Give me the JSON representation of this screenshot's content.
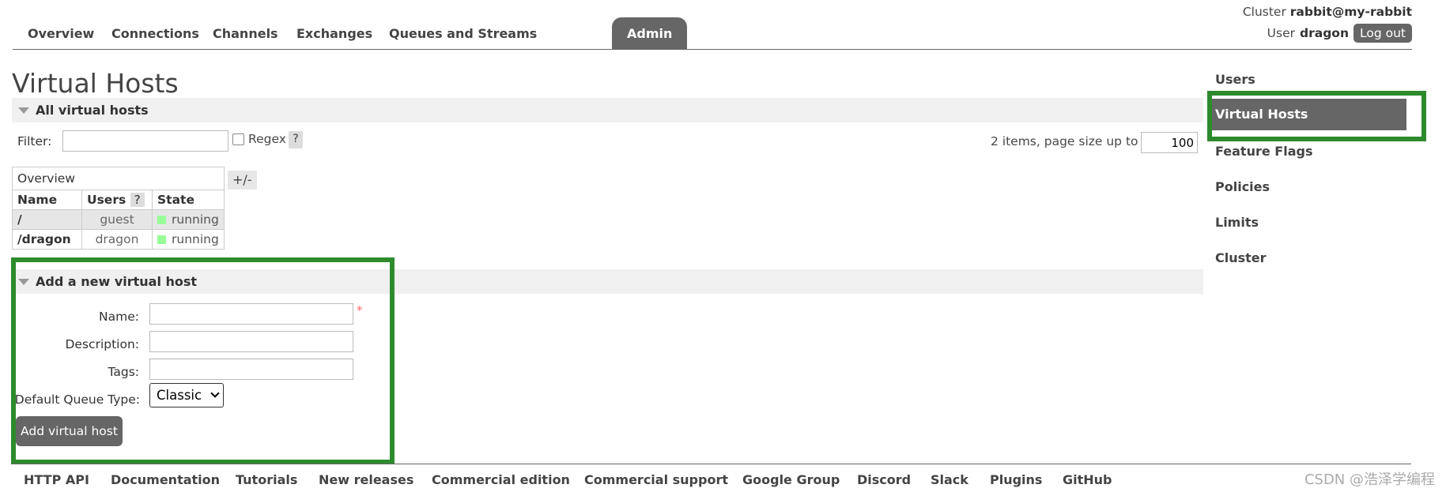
{
  "nav": {
    "tabs": [
      {
        "label": "Overview"
      },
      {
        "label": "Connections"
      },
      {
        "label": "Channels"
      },
      {
        "label": "Exchanges"
      },
      {
        "label": "Queues and Streams"
      },
      {
        "label": "Admin",
        "active": true
      }
    ]
  },
  "header": {
    "cluster_label": "Cluster",
    "cluster_name": "rabbit@my-rabbit",
    "user_label": "User",
    "user_name": "dragon",
    "logout_label": "Log out"
  },
  "page_title": "Virtual Hosts",
  "all_vhosts": {
    "section_title": "All virtual hosts",
    "filter_label": "Filter:",
    "filter_value": "",
    "regex_label": "Regex",
    "regex_checked": false,
    "help": "?",
    "items_text": "2 items, page size up to",
    "page_size": "100",
    "table": {
      "group_header": "Overview",
      "columns_toggle": "+/-",
      "columns": [
        "Name",
        "Users",
        "State"
      ],
      "rows": [
        {
          "name": "/",
          "users": "guest",
          "state": "running"
        },
        {
          "name": "/dragon",
          "users": "dragon",
          "state": "running"
        }
      ]
    }
  },
  "add_vhost": {
    "section_title": "Add a new virtual host",
    "name_label": "Name:",
    "required_mark": "*",
    "description_label": "Description:",
    "tags_label": "Tags:",
    "queue_type_label": "Default Queue Type:",
    "queue_type_value": "Classic",
    "submit_label": "Add virtual host"
  },
  "sidebar": {
    "items": [
      {
        "label": "Users"
      },
      {
        "label": "Virtual Hosts",
        "active": true
      },
      {
        "label": "Feature Flags"
      },
      {
        "label": "Policies"
      },
      {
        "label": "Limits"
      },
      {
        "label": "Cluster"
      }
    ]
  },
  "footer": {
    "links": [
      "HTTP API",
      "Documentation",
      "Tutorials",
      "New releases",
      "Commercial edition",
      "Commercial support",
      "Google Group",
      "Discord",
      "Slack",
      "Plugins",
      "GitHub"
    ]
  },
  "watermark": "CSDN @浩泽学编程",
  "colors": {
    "accent": "#666666",
    "highlight_box": "#2d8a2d",
    "running": "#99ff99"
  }
}
